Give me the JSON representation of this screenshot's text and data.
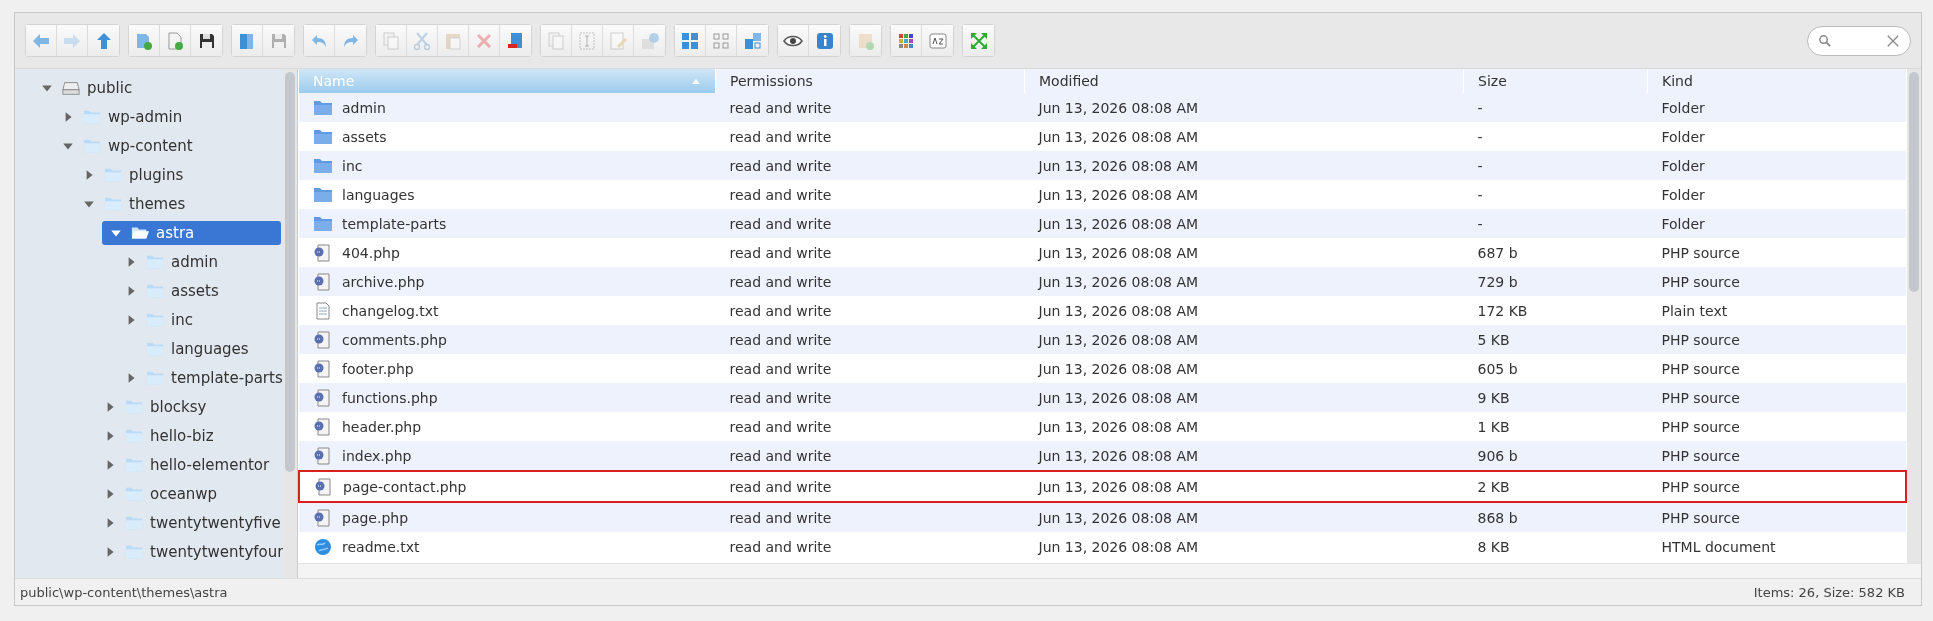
{
  "toolbar": {
    "groups": [
      [
        {
          "kind": "back",
          "disabled": false
        },
        {
          "kind": "forward",
          "disabled": true
        },
        {
          "kind": "up",
          "disabled": false
        }
      ],
      [
        {
          "kind": "new-folder",
          "disabled": false
        },
        {
          "kind": "new-file",
          "disabled": false
        },
        {
          "kind": "disk",
          "disabled": false
        }
      ],
      [
        {
          "kind": "book",
          "disabled": false
        },
        {
          "kind": "disk",
          "disabled": true
        }
      ],
      [
        {
          "kind": "undo",
          "disabled": false
        },
        {
          "kind": "redo",
          "disabled": false
        }
      ],
      [
        {
          "kind": "copy",
          "disabled": true
        },
        {
          "kind": "cut",
          "disabled": true
        },
        {
          "kind": "paste",
          "disabled": true
        },
        {
          "kind": "delete",
          "disabled": true
        },
        {
          "kind": "trash",
          "disabled": false
        }
      ],
      [
        {
          "kind": "duplicate",
          "disabled": true
        },
        {
          "kind": "rename",
          "disabled": true
        },
        {
          "kind": "edit",
          "disabled": true
        },
        {
          "kind": "extract",
          "disabled": true
        }
      ],
      [
        {
          "kind": "view-large",
          "disabled": false
        },
        {
          "kind": "view-small",
          "disabled": false
        },
        {
          "kind": "view-mixed",
          "disabled": false
        }
      ],
      [
        {
          "kind": "preview",
          "disabled": false
        },
        {
          "kind": "info",
          "disabled": false
        }
      ],
      [
        {
          "kind": "archive",
          "disabled": true
        }
      ],
      [
        {
          "kind": "dots",
          "disabled": false
        },
        {
          "kind": "sort",
          "disabled": false
        }
      ],
      [
        {
          "kind": "fullscreen",
          "disabled": false
        }
      ]
    ]
  },
  "tree": [
    {
      "label": "public",
      "kind": "drive",
      "expanded": true,
      "selected": false,
      "children": [
        {
          "label": "wp-admin",
          "kind": "folder",
          "expanded": false,
          "selected": false
        },
        {
          "label": "wp-content",
          "kind": "folder",
          "expanded": true,
          "selected": false,
          "children": [
            {
              "label": "plugins",
              "kind": "folder",
              "expanded": false,
              "selected": false
            },
            {
              "label": "themes",
              "kind": "folder",
              "expanded": true,
              "selected": false,
              "children": [
                {
                  "label": "astra",
                  "kind": "folder",
                  "expanded": true,
                  "selected": true,
                  "children": [
                    {
                      "label": "admin",
                      "kind": "folder",
                      "expanded": false,
                      "selected": false
                    },
                    {
                      "label": "assets",
                      "kind": "folder",
                      "expanded": false,
                      "selected": false
                    },
                    {
                      "label": "inc",
                      "kind": "folder",
                      "expanded": false,
                      "selected": false
                    },
                    {
                      "label": "languages",
                      "kind": "empty",
                      "expanded": false,
                      "selected": false
                    },
                    {
                      "label": "template-parts",
                      "kind": "folder",
                      "expanded": false,
                      "selected": false
                    }
                  ]
                },
                {
                  "label": "blocksy",
                  "kind": "folder",
                  "expanded": false,
                  "selected": false
                },
                {
                  "label": "hello-biz",
                  "kind": "folder",
                  "expanded": false,
                  "selected": false
                },
                {
                  "label": "hello-elementor",
                  "kind": "folder",
                  "expanded": false,
                  "selected": false
                },
                {
                  "label": "oceanwp",
                  "kind": "folder",
                  "expanded": false,
                  "selected": false
                },
                {
                  "label": "twentytwentyfive",
                  "kind": "folder",
                  "expanded": false,
                  "selected": false
                },
                {
                  "label": "twentytwentyfour",
                  "kind": "folder",
                  "expanded": false,
                  "selected": false
                }
              ]
            }
          ]
        }
      ]
    }
  ],
  "table": {
    "columns": [
      {
        "label": "Name",
        "sorted": true
      },
      {
        "label": "Permissions",
        "sorted": false
      },
      {
        "label": "Modified",
        "sorted": false
      },
      {
        "label": "Size",
        "sorted": false
      },
      {
        "label": "Kind",
        "sorted": false
      }
    ],
    "rows": [
      {
        "kind": "folder",
        "name": "admin",
        "permissions": "read and write",
        "modified": "Jun 13, 2026 08:08 AM",
        "size": "-",
        "file_type": "Folder",
        "highlighted": false
      },
      {
        "kind": "folder",
        "name": "assets",
        "permissions": "read and write",
        "modified": "Jun 13, 2026 08:08 AM",
        "size": "-",
        "file_type": "Folder",
        "highlighted": false
      },
      {
        "kind": "folder",
        "name": "inc",
        "permissions": "read and write",
        "modified": "Jun 13, 2026 08:08 AM",
        "size": "-",
        "file_type": "Folder",
        "highlighted": false
      },
      {
        "kind": "folder",
        "name": "languages",
        "permissions": "read and write",
        "modified": "Jun 13, 2026 08:08 AM",
        "size": "-",
        "file_type": "Folder",
        "highlighted": false
      },
      {
        "kind": "folder",
        "name": "template-parts",
        "permissions": "read and write",
        "modified": "Jun 13, 2026 08:08 AM",
        "size": "-",
        "file_type": "Folder",
        "highlighted": false
      },
      {
        "kind": "php",
        "name": "404.php",
        "permissions": "read and write",
        "modified": "Jun 13, 2026 08:08 AM",
        "size": "687 b",
        "file_type": "PHP source",
        "highlighted": false
      },
      {
        "kind": "php",
        "name": "archive.php",
        "permissions": "read and write",
        "modified": "Jun 13, 2026 08:08 AM",
        "size": "729 b",
        "file_type": "PHP source",
        "highlighted": false
      },
      {
        "kind": "text",
        "name": "changelog.txt",
        "permissions": "read and write",
        "modified": "Jun 13, 2026 08:08 AM",
        "size": "172 KB",
        "file_type": "Plain text",
        "highlighted": false
      },
      {
        "kind": "php",
        "name": "comments.php",
        "permissions": "read and write",
        "modified": "Jun 13, 2026 08:08 AM",
        "size": "5 KB",
        "file_type": "PHP source",
        "highlighted": false
      },
      {
        "kind": "php",
        "name": "footer.php",
        "permissions": "read and write",
        "modified": "Jun 13, 2026 08:08 AM",
        "size": "605 b",
        "file_type": "PHP source",
        "highlighted": false
      },
      {
        "kind": "php",
        "name": "functions.php",
        "permissions": "read and write",
        "modified": "Jun 13, 2026 08:08 AM",
        "size": "9 KB",
        "file_type": "PHP source",
        "highlighted": false
      },
      {
        "kind": "php",
        "name": "header.php",
        "permissions": "read and write",
        "modified": "Jun 13, 2026 08:08 AM",
        "size": "1 KB",
        "file_type": "PHP source",
        "highlighted": false
      },
      {
        "kind": "php",
        "name": "index.php",
        "permissions": "read and write",
        "modified": "Jun 13, 2026 08:08 AM",
        "size": "906 b",
        "file_type": "PHP source",
        "highlighted": false
      },
      {
        "kind": "php",
        "name": "page-contact.php",
        "permissions": "read and write",
        "modified": "Jun 13, 2026 08:08 AM",
        "size": "2 KB",
        "file_type": "PHP source",
        "highlighted": true
      },
      {
        "kind": "php",
        "name": "page.php",
        "permissions": "read and write",
        "modified": "Jun 13, 2026 08:08 AM",
        "size": "868 b",
        "file_type": "PHP source",
        "highlighted": false
      },
      {
        "kind": "html",
        "name": "readme.txt",
        "permissions": "read and write",
        "modified": "Jun 13, 2026 08:08 AM",
        "size": "8 KB",
        "file_type": "HTML document",
        "highlighted": false
      }
    ]
  },
  "status_bar": {
    "path": "public\\wp-content\\themes\\astra",
    "summary": "Items: 26, Size: 582 KB"
  }
}
